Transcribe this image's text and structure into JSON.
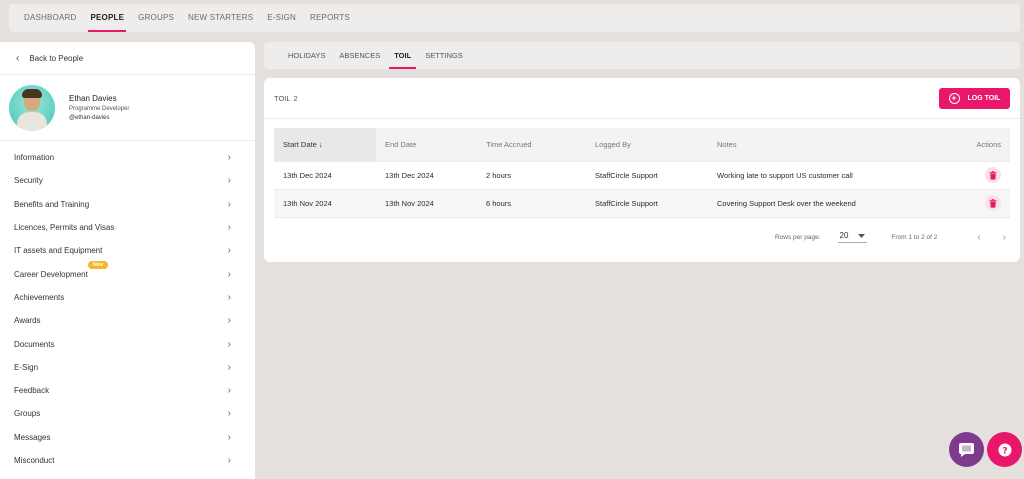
{
  "topnav": {
    "items": [
      "DASHBOARD",
      "PEOPLE",
      "GROUPS",
      "NEW STARTERS",
      "E-SIGN",
      "REPORTS"
    ],
    "active": "PEOPLE"
  },
  "sidebar": {
    "back_label": "Back to People",
    "profile": {
      "name": "Ethan Davies",
      "role": "Programme Developer",
      "handle": "@ethan-davies"
    },
    "items": [
      {
        "label": "Information"
      },
      {
        "label": "Security"
      },
      {
        "label": "Benefits and Training"
      },
      {
        "label": "Licences, Permits and Visas"
      },
      {
        "label": "IT assets and Equipment"
      },
      {
        "label": "Career Development",
        "badge": "New"
      },
      {
        "label": "Achievements"
      },
      {
        "label": "Awards"
      },
      {
        "label": "Documents"
      },
      {
        "label": "E-Sign"
      },
      {
        "label": "Feedback"
      },
      {
        "label": "Groups"
      },
      {
        "label": "Messages"
      },
      {
        "label": "Misconduct"
      }
    ]
  },
  "subnav": {
    "tabs": [
      "HOLIDAYS",
      "ABSENCES",
      "TOIL",
      "SETTINGS"
    ],
    "active": "TOIL"
  },
  "panel": {
    "title": "TOIL",
    "count": "2",
    "log_button": "LOG TOIL"
  },
  "table": {
    "columns": [
      "Start Date",
      "End Date",
      "Time Accrued",
      "Logged By",
      "Notes",
      "Actions"
    ],
    "sort_indicator": "↓",
    "rows": [
      [
        "13th Dec 2024",
        "13th Dec 2024",
        "2 hours",
        "StaffCircle Support",
        "Working late to support US customer call"
      ],
      [
        "13th Nov 2024",
        "13th Nov 2024",
        "6 hours",
        "StaffCircle Support",
        "Covering Support Desk over the weekend"
      ]
    ]
  },
  "pager": {
    "rows_label": "Rows per page:",
    "rows_value": "20",
    "range": "From 1 to 2 of 2"
  },
  "colors": {
    "accent": "#e8176b",
    "chat": "#7e3b8e",
    "badge": "#f6b626"
  }
}
